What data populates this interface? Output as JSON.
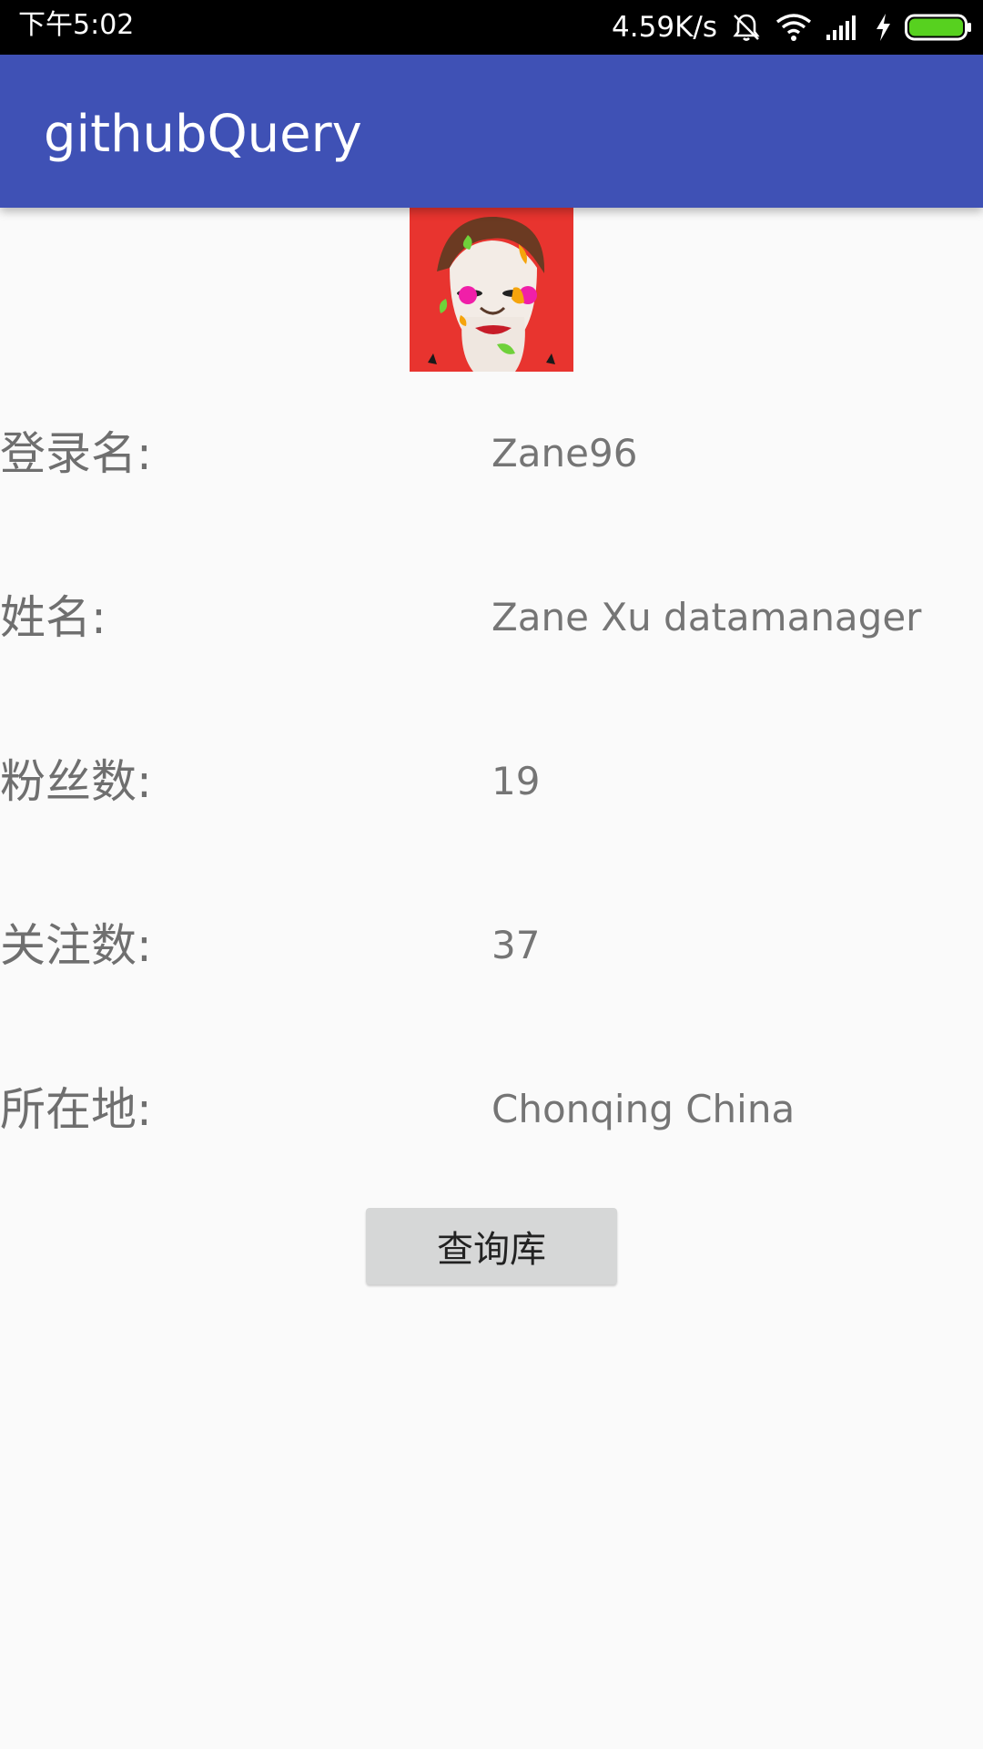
{
  "status_bar": {
    "time": "下午5:02",
    "net_speed": "4.59K/s",
    "icons": [
      "mute-icon",
      "wifi-icon",
      "signal-icon",
      "charging-icon",
      "battery-icon"
    ],
    "battery_color": "#57d11f"
  },
  "app_bar": {
    "title": "githubQuery",
    "color": "#3f51b5"
  },
  "profile": {
    "avatar": "user-avatar",
    "rows": [
      {
        "label": "登录名:",
        "value": "Zane96"
      },
      {
        "label": "姓名:",
        "value": "Zane Xu datamanager"
      },
      {
        "label": "粉丝数:",
        "value": "19"
      },
      {
        "label": "关注数:",
        "value": "37"
      },
      {
        "label": "所在地:",
        "value": "Chonqing China"
      }
    ]
  },
  "actions": {
    "repo_button_label": "查询库"
  }
}
